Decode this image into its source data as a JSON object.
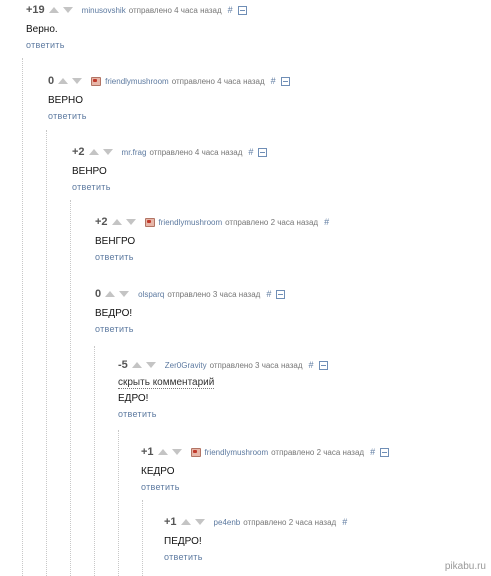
{
  "comments": [
    {
      "score": "+19",
      "user": "minusovshik",
      "posted": "отправлено 4 часа назад",
      "hash": "#",
      "text": "Верно.",
      "reply": "ответить"
    },
    {
      "score": "0",
      "user": "friendlymushroom",
      "posted": "отправлено 4 часа назад",
      "hash": "#",
      "text": "ВЕРНО",
      "reply": "ответить"
    },
    {
      "score": "+2",
      "user": "mr.frag",
      "posted": "отправлено 4 часа назад",
      "hash": "#",
      "text": "ВЕНРО",
      "reply": "ответить"
    },
    {
      "score": "+2",
      "user": "friendlymushroom",
      "posted": "отправлено 2 часа назад",
      "hash": "#",
      "text": "ВЕНГРО",
      "reply": "ответить"
    },
    {
      "score": "0",
      "user": "olsparq",
      "posted": "отправлено 3 часа назад",
      "hash": "#",
      "text": "ВЕДРО!",
      "reply": "ответить"
    },
    {
      "score": "-5",
      "user": "Zer0Gravity",
      "posted": "отправлено 3 часа назад",
      "hash": "#",
      "hide_label": "скрыть комментарий",
      "text": "ЕДРО!",
      "reply": "ответить"
    },
    {
      "score": "+1",
      "user": "friendlymushroom",
      "posted": "отправлено 2 часа назад",
      "hash": "#",
      "text": "КЕДРО",
      "reply": "ответить"
    },
    {
      "score": "+1",
      "user": "pe4enb",
      "posted": "отправлено 2 часа назад",
      "hash": "#",
      "text": "ПЕДРО!",
      "reply": "ответить"
    }
  ],
  "watermark": "pikabu.ru",
  "icons": {
    "up": "arrow-up-icon",
    "down": "arrow-down-icon",
    "collapse": "collapse-icon",
    "avatar": "user-avatar-icon"
  },
  "colors": {
    "link": "#5d7aa0",
    "score": "#555555",
    "arrow": "#c4c4c4",
    "text": "#111111"
  }
}
